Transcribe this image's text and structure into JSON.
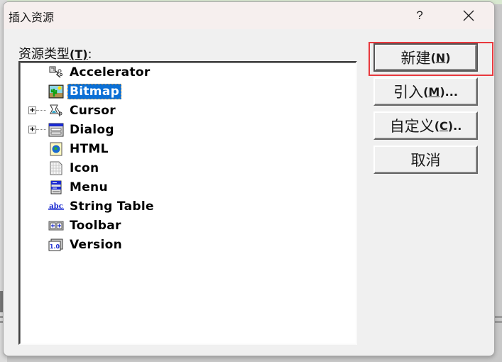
{
  "dialog": {
    "title": "插入资源",
    "help_label": "?",
    "close_icon": "close-icon"
  },
  "resource_types": {
    "label": "资源类型",
    "accelerator_key": "(T)",
    "label_suffix": ":",
    "items": [
      {
        "label": "Accelerator",
        "icon": "accelerator-icon",
        "expandable": false,
        "selected": false
      },
      {
        "label": "Bitmap",
        "icon": "bitmap-icon",
        "expandable": false,
        "selected": true
      },
      {
        "label": "Cursor",
        "icon": "cursor-icon",
        "expandable": true,
        "selected": false
      },
      {
        "label": "Dialog",
        "icon": "dialog-icon",
        "expandable": true,
        "selected": false
      },
      {
        "label": "HTML",
        "icon": "html-icon",
        "expandable": false,
        "selected": false
      },
      {
        "label": "Icon",
        "icon": "icon-resource-icon",
        "expandable": false,
        "selected": false
      },
      {
        "label": "Menu",
        "icon": "menu-icon",
        "expandable": false,
        "selected": false
      },
      {
        "label": "String Table",
        "icon": "string-table-icon",
        "expandable": false,
        "selected": false
      },
      {
        "label": "Toolbar",
        "icon": "toolbar-icon",
        "expandable": false,
        "selected": false
      },
      {
        "label": "Version",
        "icon": "version-icon",
        "expandable": false,
        "selected": false
      }
    ],
    "expander_symbol": "+"
  },
  "buttons": {
    "new": {
      "label": "新建",
      "accel": "N",
      "suffix": ""
    },
    "import": {
      "label": "引入",
      "accel": "M",
      "suffix": "..."
    },
    "custom": {
      "label": "自定义",
      "accel": "C",
      "suffix": ".."
    },
    "cancel": {
      "label": "取消"
    }
  },
  "annotation": {
    "highlight_color": "#e8383d",
    "highlighted": "new-button"
  },
  "colors": {
    "selection": "#0a6fd6"
  }
}
